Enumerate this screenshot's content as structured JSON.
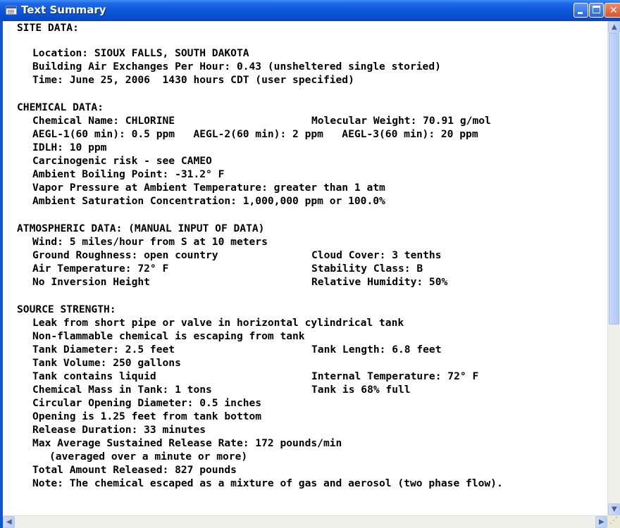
{
  "window": {
    "title": "Text Summary",
    "icons": {
      "app": "text-document-icon",
      "minimize": "minimize-icon",
      "maximize": "maximize-icon",
      "close": "close-icon",
      "scroll_up": "chevron-up-icon",
      "scroll_down": "chevron-down-icon",
      "scroll_left": "chevron-left-icon",
      "scroll_right": "chevron-right-icon"
    },
    "colors": {
      "titlebar": "#0a55d8",
      "background": "#ffffff",
      "text": "#000000"
    }
  },
  "summary": {
    "site": {
      "header": "SITE DATA:",
      "location": "Location: SIOUX FALLS, SOUTH DAKOTA",
      "air_exchanges": "Building Air Exchanges Per Hour: 0.43 (unsheltered single storied)",
      "time": "Time: June 25, 2006  1430 hours CDT (user specified)"
    },
    "chemical": {
      "header": "CHEMICAL DATA:",
      "name": "Chemical Name: CHLORINE",
      "molecular_weight": "Molecular Weight: 70.91 g/mol",
      "aegl": "AEGL-1(60 min): 0.5 ppm   AEGL-2(60 min): 2 ppm   AEGL-3(60 min): 20 ppm",
      "idlh": "IDLH: 10 ppm",
      "carcinogenic": "Carcinogenic risk - see CAMEO",
      "boiling_point": "Ambient Boiling Point: -31.2° F",
      "vapor_pressure": "Vapor Pressure at Ambient Temperature: greater than 1 atm",
      "saturation": "Ambient Saturation Concentration: 1,000,000 ppm or 100.0%"
    },
    "atmospheric": {
      "header": "ATMOSPHERIC DATA: (MANUAL INPUT OF DATA)",
      "wind": "Wind: 5 miles/hour from S at 10 meters",
      "ground_roughness": "Ground Roughness: open country",
      "cloud_cover": "Cloud Cover: 3 tenths",
      "air_temperature": "Air Temperature: 72° F",
      "stability_class": "Stability Class: B",
      "inversion": "No Inversion Height",
      "humidity": "Relative Humidity: 50%"
    },
    "source": {
      "header": "SOURCE STRENGTH:",
      "leak": "Leak from short pipe or valve in horizontal cylindrical tank",
      "flammability": "Non-flammable chemical is escaping from tank",
      "tank_diameter": "Tank Diameter: 2.5 feet",
      "tank_length": "Tank Length: 6.8 feet",
      "tank_volume": "Tank Volume: 250 gallons",
      "tank_contents": "Tank contains liquid",
      "internal_temperature": "Internal Temperature: 72° F",
      "chemical_mass": "Chemical Mass in Tank: 1 tons",
      "tank_fill": "Tank is 68% full",
      "opening_diameter": "Circular Opening Diameter: 0.5 inches",
      "opening_height": "Opening is 1.25 feet from tank bottom",
      "release_duration": "Release Duration: 33 minutes",
      "release_rate": "Max Average Sustained Release Rate: 172 pounds/min",
      "release_rate_note": "(averaged over a minute or more)",
      "total_released": "Total Amount Released: 827 pounds",
      "note": "Note: The chemical escaped as a mixture of gas and aerosol (two phase flow)."
    }
  },
  "scrollbar": {
    "vertical_position": 0,
    "vertical_visible_fraction": 0.62
  }
}
